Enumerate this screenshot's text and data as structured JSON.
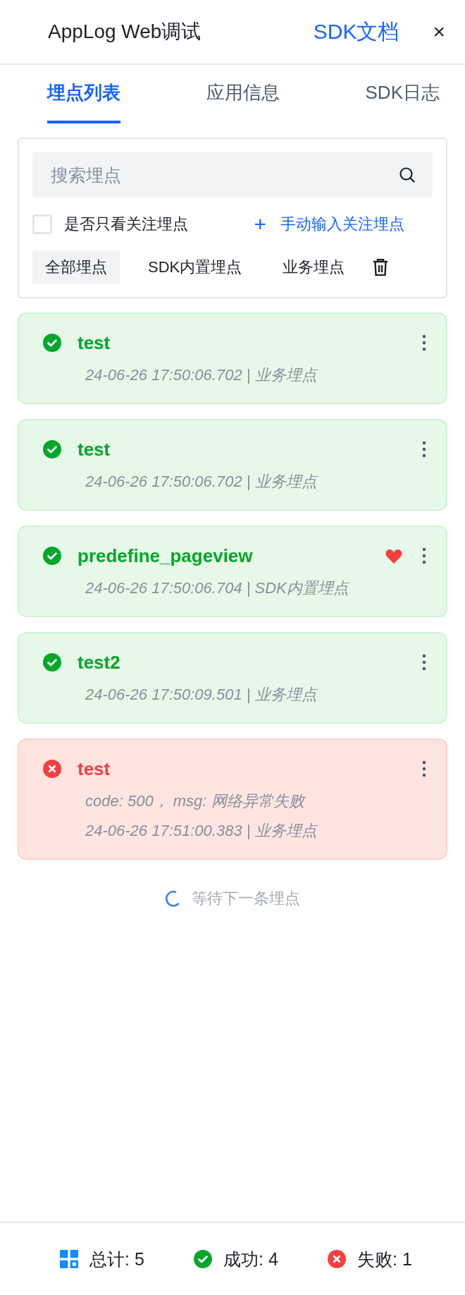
{
  "header": {
    "title": "AppLog Web调试",
    "doc_link": "SDK文档",
    "close": "×"
  },
  "tabs": [
    {
      "label": "埋点列表",
      "selected": true
    },
    {
      "label": "应用信息",
      "selected": false
    },
    {
      "label": "SDK日志",
      "selected": false
    }
  ],
  "filter": {
    "search": {
      "placeholder": "搜索埋点"
    },
    "follow_only": {
      "label": "是否只看关注埋点",
      "checked": false
    },
    "add_follow": {
      "icon": "+",
      "label": "手动输入关注埋点"
    },
    "categories": [
      {
        "label": "全部埋点",
        "selected": true
      },
      {
        "label": "SDK内置埋点",
        "selected": false
      },
      {
        "label": "业务埋点",
        "selected": false
      }
    ]
  },
  "events": [
    {
      "name": "test",
      "kind": "success",
      "favorite": false,
      "meta": "24-06-26 17:50:06.702 | 业务埋点"
    },
    {
      "name": "test",
      "kind": "success",
      "favorite": false,
      "meta": "24-06-26 17:50:06.702 | 业务埋点"
    },
    {
      "name": "predefine_pageview",
      "kind": "success",
      "favorite": true,
      "meta": "24-06-26 17:50:06.704 | SDK内置埋点"
    },
    {
      "name": "test2",
      "kind": "success",
      "favorite": false,
      "meta": "24-06-26 17:50:09.501 | 业务埋点"
    },
    {
      "name": "test",
      "kind": "error",
      "favorite": false,
      "error": "code: 500， msg: 网络异常失败",
      "meta": "24-06-26 17:51:00.383 | 业务埋点"
    }
  ],
  "waiting": "等待下一条埋点",
  "footer": [
    {
      "kind": "total",
      "label": "总计: 5"
    },
    {
      "kind": "success",
      "label": "成功: 4"
    },
    {
      "kind": "error",
      "label": "失败: 1"
    }
  ]
}
